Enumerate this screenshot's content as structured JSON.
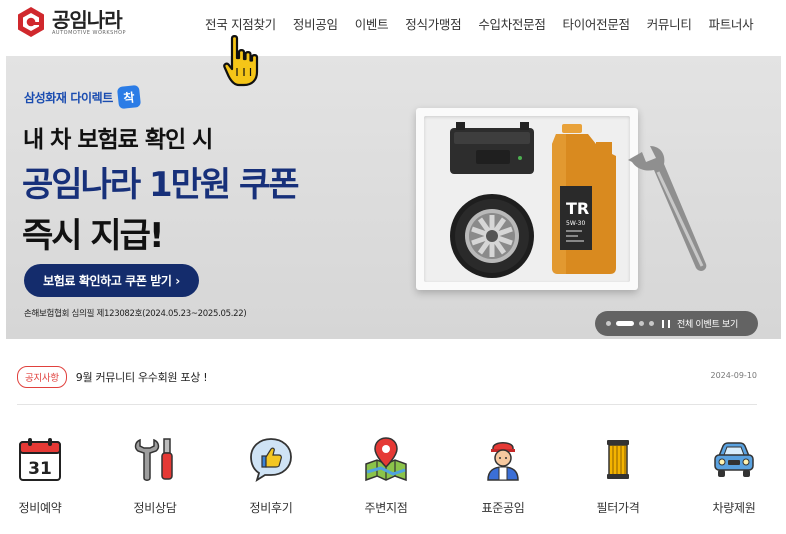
{
  "header": {
    "logo_name": "공임나라",
    "logo_sub": "AUTOMOTIVE WORKSHOP",
    "logo_icon": "hexagon-logo-icon",
    "nav": [
      "전국 지점찾기",
      "정비공임",
      "이벤트",
      "정식가맹점",
      "수입차전문점",
      "타이어전문점",
      "커뮤니티",
      "파트너사"
    ]
  },
  "cursor": {
    "icon": "hand-pointer-icon"
  },
  "banner": {
    "brand": "삼성화재 다이렉트",
    "brand_badge": "착",
    "line1": "내 차 보험료 확인 시",
    "line2": "공임나라 1만원 쿠폰",
    "line3": "즉시 지급!",
    "cta": "보험료 확인하고 쿠폰 받기 ›",
    "note": "손해보험협회 심의필 제123082호(2024.05.23~2025.05.22)",
    "product_label": "TR",
    "product_grade": "5W-30",
    "view_all": "전체 이벤트 보기",
    "slide_count": 4,
    "active_slide": 2,
    "colors": {
      "headline": "#17307a",
      "cta_bg": "#142c6c",
      "brand": "#1a4cb0"
    }
  },
  "notice": {
    "badge": "공지사항",
    "text": "9월 커뮤니티 우수회원 포상 !",
    "date": "2024-09-10",
    "accent": "#e0413d"
  },
  "quick_menu": [
    {
      "label": "정비예약",
      "icon": "calendar-icon",
      "icon_text": "31"
    },
    {
      "label": "정비상담",
      "icon": "wrench-screwdriver-icon"
    },
    {
      "label": "정비후기",
      "icon": "thumbs-up-bubble-icon"
    },
    {
      "label": "주변지점",
      "icon": "map-pin-icon"
    },
    {
      "label": "표준공임",
      "icon": "mechanic-icon"
    },
    {
      "label": "필터가격",
      "icon": "filter-icon"
    },
    {
      "label": "차량제원",
      "icon": "car-icon"
    }
  ]
}
